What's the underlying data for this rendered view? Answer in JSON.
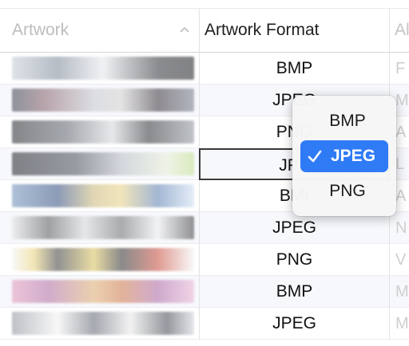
{
  "columns": {
    "artwork": "Artwork",
    "format": "Artwork Format",
    "album": "Al"
  },
  "rows": [
    {
      "format": "BMP",
      "album": "F"
    },
    {
      "format": "JPEG",
      "album": "M"
    },
    {
      "format": "PNG",
      "album": "A"
    },
    {
      "format": "JPEG",
      "album": "L"
    },
    {
      "format": "BMP",
      "album": "A"
    },
    {
      "format": "JPEG",
      "album": "N"
    },
    {
      "format": "PNG",
      "album": "V"
    },
    {
      "format": "BMP",
      "album": "M"
    },
    {
      "format": "JPEG",
      "album": "M"
    }
  ],
  "visible_text": {
    "row2_partial": "JPEG",
    "row3_partial": "PNG",
    "row4_partial": "JPE",
    "row5_partial": "BMI"
  },
  "popup": {
    "options": [
      "BMP",
      "JPEG",
      "PNG"
    ],
    "selected": "JPEG"
  },
  "colors": {
    "accent": "#2f7bf6"
  },
  "icons": {
    "sort": "chevron-up-icon",
    "check": "checkmark-icon"
  }
}
